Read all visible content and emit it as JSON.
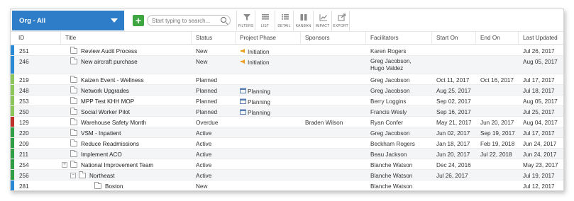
{
  "org_select": {
    "label": "Org - All"
  },
  "search": {
    "placeholder": "Start typing to search..."
  },
  "tools": [
    {
      "label": "FILTERS",
      "icon": "filter-icon"
    },
    {
      "label": "LIST",
      "icon": "list-icon"
    },
    {
      "label": "DETAIL",
      "icon": "detail-icon"
    },
    {
      "label": "KANBAN",
      "icon": "kanban-icon"
    },
    {
      "label": "IMPACT",
      "icon": "chart-icon"
    },
    {
      "label": "EXPORT",
      "icon": "export-icon"
    }
  ],
  "columns": {
    "id": "ID",
    "title": "Title",
    "status": "Status",
    "phase": "Project Phase",
    "sponsors": "Sponsors",
    "facilitators": "Facilitators",
    "start": "Start On",
    "end": "End On",
    "updated": "Last Updated"
  },
  "colors": {
    "blue": "#2b8ad6",
    "green": "#8cc65a",
    "darkgreen": "#2f9e44",
    "red": "#c0302b",
    "accent": "#2e7dc8",
    "add": "#3ea640",
    "initiation": "#f0a020",
    "planning": "#5a7fb5"
  },
  "rows": [
    {
      "id": "251",
      "title": "Review Audit Process",
      "status": "New",
      "phase": "Initiation",
      "sponsors": "",
      "facilitators": [
        "Karen Rogers"
      ],
      "start": "",
      "end": "",
      "updated": "Jul 26, 2017",
      "bar": "blue",
      "level": 0,
      "expander": ""
    },
    {
      "id": "246",
      "title": "New aircraft purchase",
      "status": "New",
      "phase": "Initiation",
      "sponsors": "",
      "facilitators": [
        "Greg Jacobson,",
        "Hugo Valdez"
      ],
      "start": "",
      "end": "",
      "updated": "Aug 05, 2017",
      "bar": "blue",
      "level": 0,
      "expander": ""
    },
    {
      "id": "219",
      "title": "Kaizen Event - Wellness",
      "status": "Planned",
      "phase": "",
      "sponsors": "",
      "facilitators": [
        "Greg Jacobson"
      ],
      "start": "Oct 11, 2017",
      "end": "Oct 16, 2017",
      "updated": "Jul 17, 2017",
      "bar": "green",
      "level": 0,
      "expander": ""
    },
    {
      "id": "248",
      "title": "Network Upgrades",
      "status": "Planned",
      "phase": "Planning",
      "sponsors": "",
      "facilitators": [
        "Greg Jacobson"
      ],
      "start": "Aug 25, 2017",
      "end": "",
      "updated": "Jul 18, 2017",
      "bar": "green",
      "level": 0,
      "expander": ""
    },
    {
      "id": "253",
      "title": "MPP Test KHH MOP",
      "status": "Planned",
      "phase": "Planning",
      "sponsors": "",
      "facilitators": [
        "Berry Loggins"
      ],
      "start": "Sep 02, 2017",
      "end": "",
      "updated": "Aug 05, 2017",
      "bar": "green",
      "level": 0,
      "expander": ""
    },
    {
      "id": "250",
      "title": "Social Worker Pilot",
      "status": "Planned",
      "phase": "Planning",
      "sponsors": "",
      "facilitators": [
        "Francis Wesly"
      ],
      "start": "Sep 16, 2017",
      "end": "",
      "updated": "Jul 25, 2017",
      "bar": "green",
      "level": 0,
      "expander": ""
    },
    {
      "id": "129",
      "title": "Warehouse Safety Month",
      "status": "Overdue",
      "phase": "",
      "sponsors": "Braden Wilson",
      "facilitators": [
        "Ryan Confer"
      ],
      "start": "May 21, 2017",
      "end": "Jun 20, 2017",
      "updated": "Aug 04, 2017",
      "bar": "red",
      "level": 0,
      "expander": ""
    },
    {
      "id": "220",
      "title": "VSM - Inpatient",
      "status": "Active",
      "phase": "",
      "sponsors": "",
      "facilitators": [
        "Greg Jacobson"
      ],
      "start": "Jun 02, 2017",
      "end": "Sep 19, 2017",
      "updated": "Jul 17, 2017",
      "bar": "darkgreen",
      "level": 0,
      "expander": ""
    },
    {
      "id": "209",
      "title": "Reduce Readmissions",
      "status": "Active",
      "phase": "",
      "sponsors": "",
      "facilitators": [
        "Beckham Rogers"
      ],
      "start": "Jan 18, 2017",
      "end": "Feb 19, 2018",
      "updated": "Jun 24, 2017",
      "bar": "darkgreen",
      "level": 0,
      "expander": ""
    },
    {
      "id": "211",
      "title": "Implement ACO",
      "status": "Active",
      "phase": "",
      "sponsors": "",
      "facilitators": [
        "Beau Jackson"
      ],
      "start": "Jun 20, 2017",
      "end": "Jul 22, 2018",
      "updated": "Jun 24, 2017",
      "bar": "darkgreen",
      "level": 0,
      "expander": ""
    },
    {
      "id": "254",
      "title": "National Improvement Team",
      "status": "Active",
      "phase": "",
      "sponsors": "",
      "facilitators": [
        "Blanche Watson"
      ],
      "start": "Dec 24, 2016",
      "end": "",
      "updated": "May 23, 2017",
      "bar": "darkgreen",
      "level": 0,
      "expander": "+"
    },
    {
      "id": "256",
      "title": "Northeast",
      "status": "Active",
      "phase": "",
      "sponsors": "",
      "facilitators": [
        "Blanche Watson"
      ],
      "start": "Jul 26, 2017",
      "end": "",
      "updated": "Jul 19, 2017",
      "bar": "darkgreen",
      "level": 1,
      "expander": "−"
    },
    {
      "id": "281",
      "title": "Boston",
      "status": "New",
      "phase": "",
      "sponsors": "",
      "facilitators": [
        "Blanche Watson"
      ],
      "start": "",
      "end": "",
      "updated": "Jul 12, 2017",
      "bar": "blue",
      "level": 2,
      "expander": ""
    }
  ]
}
